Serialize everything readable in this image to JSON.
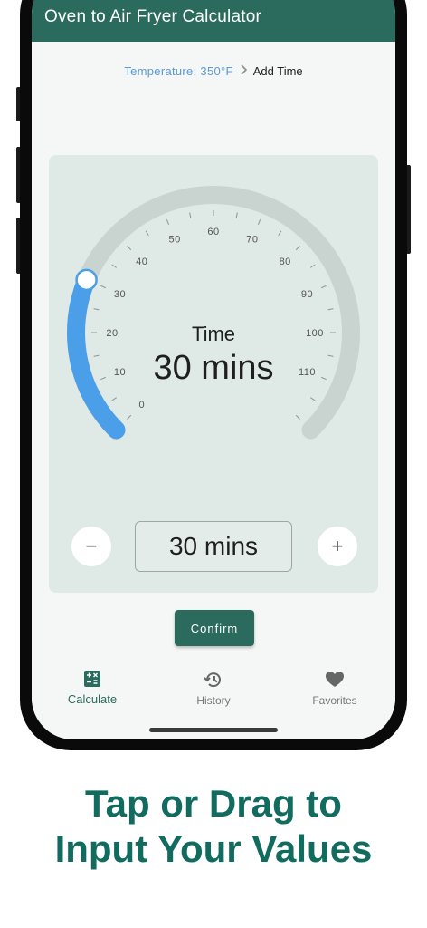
{
  "app_bar": {
    "title": "Oven to Air Fryer Calculator"
  },
  "breadcrumb": {
    "previous": "Temperature: 350°F",
    "separator": ">",
    "current": "Add Time"
  },
  "dial": {
    "label": "Time",
    "value_text": "30 mins",
    "min": 0,
    "max": 120,
    "current_value": 30,
    "tick_labels": [
      "0",
      "10",
      "20",
      "30",
      "40",
      "50",
      "60",
      "70",
      "80",
      "90",
      "100",
      "110"
    ],
    "track_color": "#c9d3cf",
    "progress_color": "#4a9fe8"
  },
  "controls": {
    "decrement_symbol": "−",
    "increment_symbol": "+",
    "input_value": "30 mins"
  },
  "confirm": {
    "label": "Confirm"
  },
  "nav": {
    "items": [
      {
        "label": "Calculate",
        "icon": "calculator-icon",
        "active": true
      },
      {
        "label": "History",
        "icon": "history-icon",
        "active": false
      },
      {
        "label": "Favorites",
        "icon": "heart-icon",
        "active": false
      }
    ]
  },
  "promo": {
    "line1": "Tap or Drag to",
    "line2": "Input Your Values"
  },
  "colors": {
    "primary": "#2b6b5e",
    "promo_text": "#116b5e",
    "link": "#5a9ad6"
  }
}
